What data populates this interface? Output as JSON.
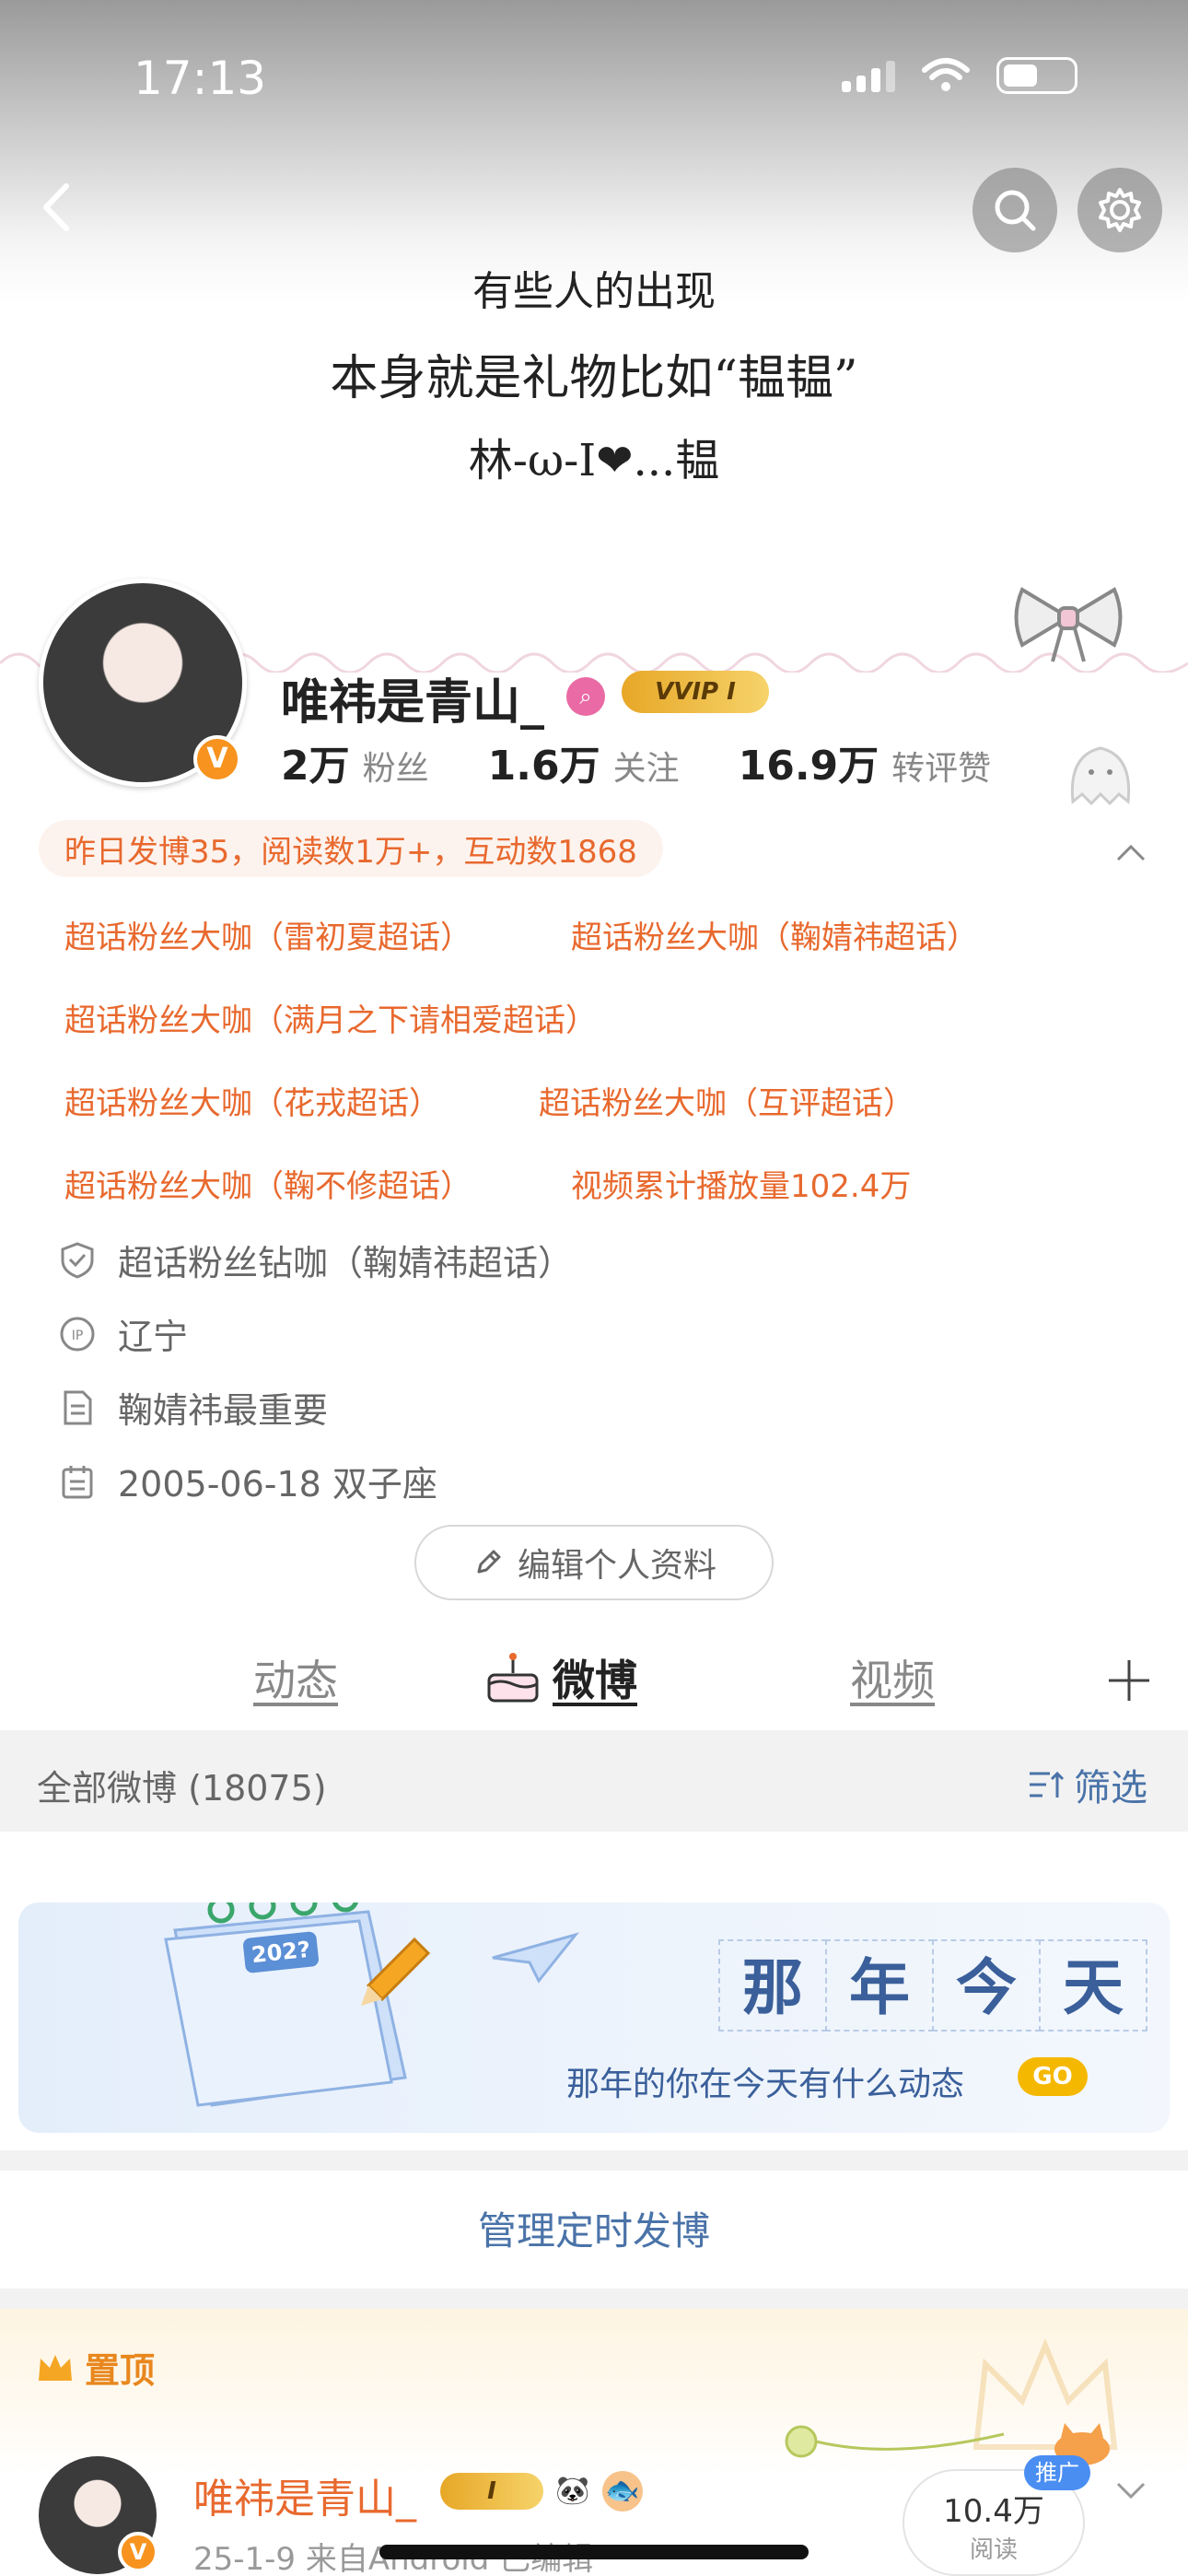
{
  "status_bar": {
    "time": "17:13"
  },
  "header": {
    "banner_lines": [
      "有些人的出现",
      "本身就是礼物比如“韫韫”",
      "林-ω-I❤...韫"
    ]
  },
  "profile": {
    "username": "唯祎是青山_",
    "verified_badge": "V",
    "vvip_label": "VVIP I",
    "stats": [
      {
        "value": "2万",
        "label": "粉丝"
      },
      {
        "value": "1.6万",
        "label": "关注"
      },
      {
        "value": "16.9万",
        "label": "转评赞"
      }
    ],
    "activity_summary": "昨日发博35，阅读数1万+，互动数1868",
    "honors": [
      "超话粉丝大咖（雷初夏超话）",
      "超话粉丝大咖（鞠婧祎超话）",
      "超话粉丝大咖（满月之下请相爱超话）",
      "超话粉丝大咖（花戎超话）",
      "超话粉丝大咖（互评超话）",
      "超话粉丝大咖（鞠不修超话）",
      "视频累计播放量102.4万"
    ],
    "info_rows": [
      {
        "icon": "shield-icon",
        "text": "超话粉丝钻咖（鞠婧祎超话）"
      },
      {
        "icon": "ip-icon",
        "text": "辽宁"
      },
      {
        "icon": "document-icon",
        "text": "鞠婧祎最重要"
      },
      {
        "icon": "calendar-icon",
        "text": "2005-06-18 双子座"
      }
    ],
    "edit_button": "编辑个人资料"
  },
  "tabs": [
    {
      "label": "动态",
      "active": false
    },
    {
      "label": "微博",
      "active": true
    },
    {
      "label": "视频",
      "active": false
    }
  ],
  "feed": {
    "count_label": "全部微博 (18075)",
    "filter_label": "筛选"
  },
  "memory_banner": {
    "calendar_year": "202?",
    "title_chars": [
      "那",
      "年",
      "今",
      "天"
    ],
    "subtitle": "那年的你在今天有什么动态",
    "go_label": "GO"
  },
  "manage_scheduled": "管理定时发博",
  "pinned": {
    "label": "置顶",
    "post": {
      "author": "唯祎是青山_",
      "vip_label": "I",
      "meta": "25-1-9  来自Android  已编辑",
      "reads_value": "10.4万",
      "reads_label": "阅读",
      "promo_label": "推广"
    }
  },
  "colors": {
    "accent_orange": "#e8692e",
    "link_blue": "#4a73a8",
    "gold": "#e7a727"
  }
}
